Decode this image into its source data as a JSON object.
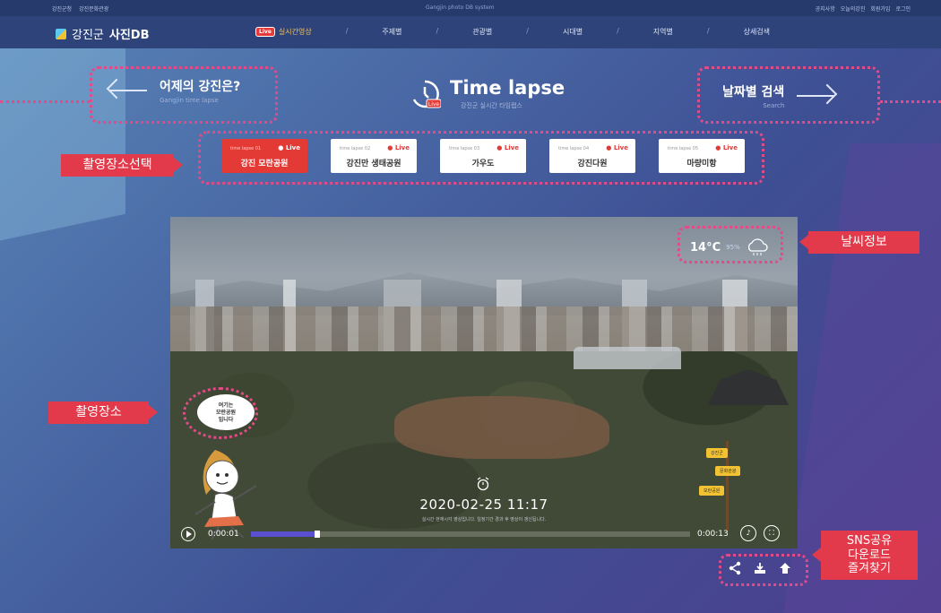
{
  "topbar": {
    "left_links": [
      "강진군청",
      "강진문화관광"
    ],
    "center_text": "Gangjin photo DB system",
    "right_links": [
      "공지사항",
      "오늘의강진",
      "회원가입",
      "로그인"
    ]
  },
  "nav": {
    "logo_region": "강진군",
    "logo_title": "사진DB",
    "live_badge": "Live",
    "items": [
      "실시간영상",
      "주제별",
      "관광별",
      "시대별",
      "지역별",
      "상세검색"
    ],
    "separator": "/"
  },
  "header": {
    "prev_title": "어제의 강진은?",
    "prev_sub": "Gangjin time lapse",
    "center_title": "Time lapse",
    "center_sub": "강진군 실시간 타임랩스",
    "center_badge": "Live",
    "next_title": "날짜별 검색",
    "next_sub": "Search"
  },
  "locations": [
    {
      "tag": "time lapse 01",
      "live": "● Live",
      "name": "강진 모란공원",
      "active": true
    },
    {
      "tag": "time lapse 02",
      "live": "● Live",
      "name": "강진만 생태공원",
      "active": false
    },
    {
      "tag": "time lapse 03",
      "live": "● Live",
      "name": "가우도",
      "active": false
    },
    {
      "tag": "time lapse 04",
      "live": "● Live",
      "name": "강진다원",
      "active": false
    },
    {
      "tag": "time lapse 05",
      "live": "● Live",
      "name": "마량미항",
      "active": false
    }
  ],
  "video": {
    "temperature": "14°C",
    "humidity": "95%",
    "timestamp": "2020-02-25 11:17",
    "caption": "실시간 현재시각 영상입니다. 일정기간 경과 후 영상이 갱신됩니다.",
    "current_time": "0:00:01",
    "end_time": "0:00:13",
    "progress": 0.15,
    "speech_line1": "여기는",
    "speech_line2": "모란공원",
    "speech_line3": "입니다",
    "signs": [
      "강진군",
      "문화관광",
      "모란공원"
    ]
  },
  "annotations": {
    "location_select": "촬영장소선택",
    "weather": "날씨정보",
    "location": "촬영장소",
    "sns_line1": "SNS공유",
    "sns_line2": "다운로드",
    "sns_line3": "즐겨찾기"
  },
  "colors": {
    "accent_red": "#e43a36",
    "annotation_pink": "#e24a88",
    "progress_fill": "#5a4fd0"
  },
  "icons": [
    "share-icon",
    "download-icon",
    "bookmark-icon"
  ]
}
